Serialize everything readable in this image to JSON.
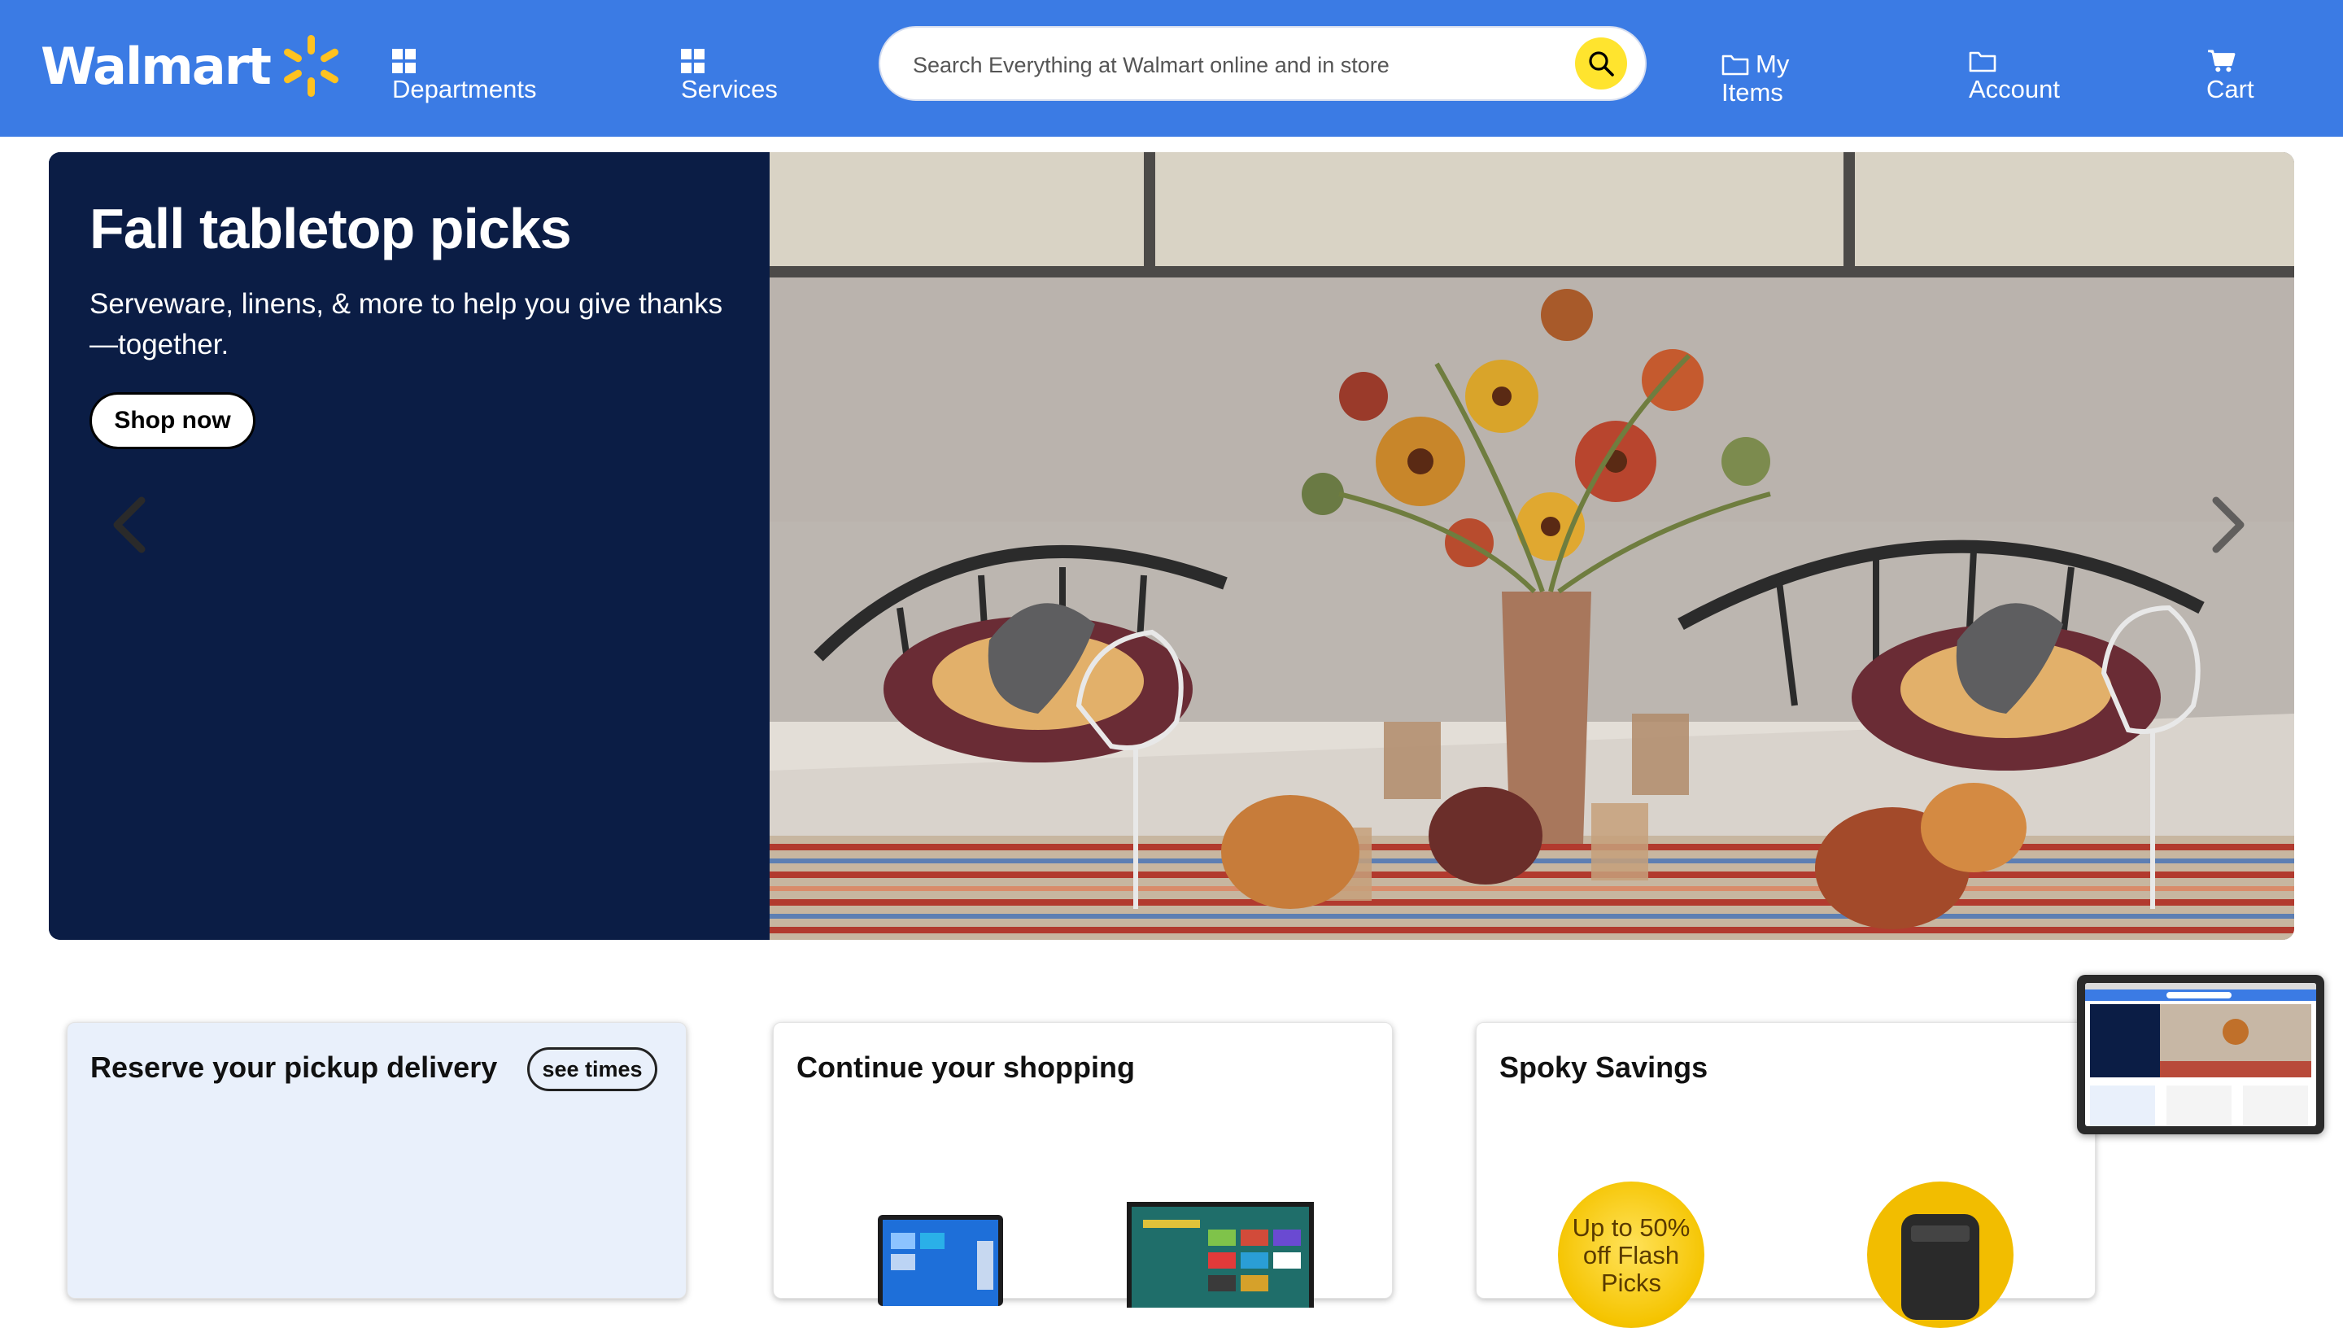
{
  "header": {
    "brand": "Walmart",
    "nav": {
      "departments": "Departments",
      "services": "Services",
      "my_items_line1": "My",
      "my_items_line2": "Items",
      "account": "Account",
      "cart": "Cart"
    },
    "search": {
      "placeholder": "Search Everything at Walmart online and in store"
    }
  },
  "hero": {
    "title": "Fall tabletop picks",
    "subtitle": "Serveware, linens, & more to help you give thanks—together.",
    "cta": "Shop now"
  },
  "cards": [
    {
      "title": "Reserve your pickup delivery",
      "action": "see times"
    },
    {
      "title": "Continue your shopping"
    },
    {
      "title": "Spoky Savings",
      "badge_line1": "Up to 50%",
      "badge_line2": "off Flash",
      "badge_line3": "Picks"
    }
  ],
  "colors": {
    "header_bg": "#3b7be4",
    "spark": "#ffc220",
    "hero_panel": "#0b1d45",
    "search_button": "#ffe42e",
    "pickup_card_bg": "#e9f0fb"
  },
  "icons": {
    "spark": "walmart-spark-icon",
    "departments": "grid-icon",
    "services": "grid-icon",
    "my_items": "folder-icon",
    "account": "folder-icon",
    "cart": "cart-icon",
    "search": "search-icon",
    "prev": "chevron-left-icon",
    "next": "chevron-right-icon"
  }
}
